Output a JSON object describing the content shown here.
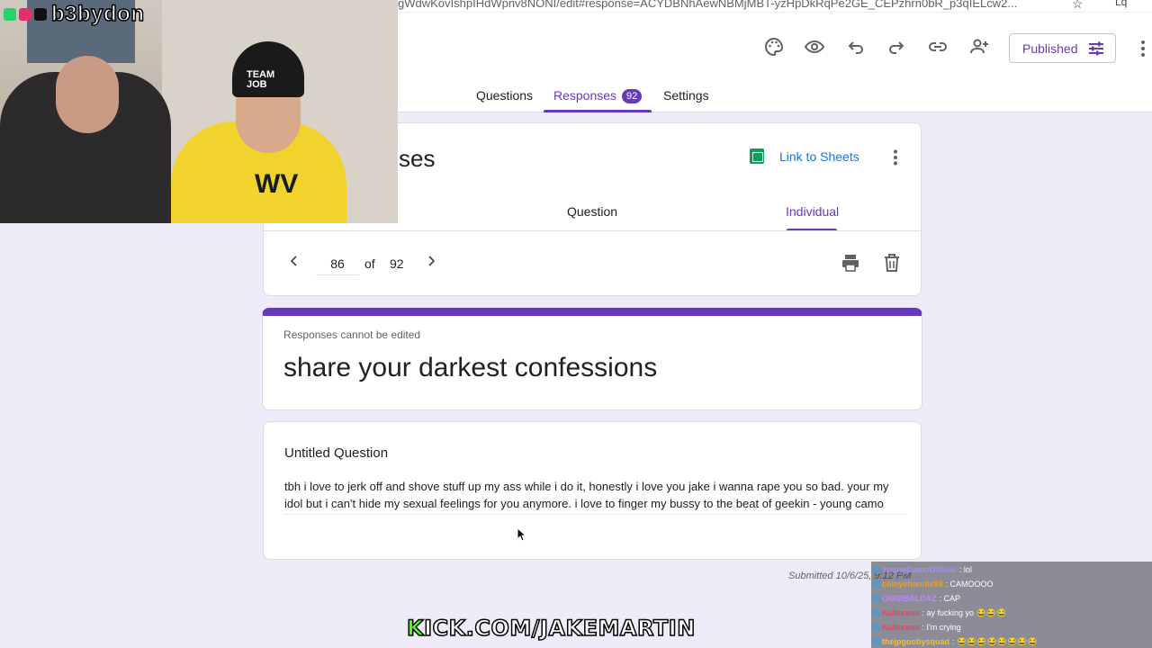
{
  "browser": {
    "url": "gWdwKovIshpIHdWpnv8NONI/edit#response=ACYDBNhAewNBMjMBT-yzHpDkRqPe2GE_CEPzhrn0bR_p3qIELcw2..."
  },
  "header": {
    "published_label": "Published",
    "tabs": {
      "questions": "Questions",
      "responses": "Responses",
      "responses_count": "92",
      "settings": "Settings"
    }
  },
  "summary": {
    "title_partial": "ses",
    "link_sheets": "Link to Sheets",
    "subtabs": {
      "question": "Question",
      "individual": "Individual"
    }
  },
  "navigator": {
    "current": "86",
    "of": "of",
    "total": "92"
  },
  "form": {
    "note": "Responses cannot be edited",
    "title": "share your darkest confessions"
  },
  "question": {
    "title": "Untitled Question",
    "answer": "tbh i love to jerk off and shove stuff up my ass while i do it, honestly i love you jake i wanna rape you so bad. your my idol but i can't hide my sexual feelings for you anymore. i love to finger my bussy to the beat of geekin - young camo"
  },
  "submitted": "Submitted 10/6/25, 9:12 PM",
  "stream": {
    "handle": "b3bydon",
    "beanie_text": "TEAM\nJOB",
    "shirt_logo": "WV",
    "kick_prefix": "K",
    "kick_rest": "ICK.COM/JAKEMARTIN",
    "chat": [
      {
        "user": "YoungCamoOfficial",
        "msg": ": lol",
        "color": "#a78bfa"
      },
      {
        "user": "billnyehandle98",
        "msg": ": CAMOOOO",
        "color": "#f59e0b"
      },
      {
        "user": "OGGIBALDAZ",
        "msg": ": CAP",
        "color": "#c084fc"
      },
      {
        "user": "Kulturess",
        "msg": ": ay fucking yo 😂😂😂",
        "color": "#f43f5e"
      },
      {
        "user": "Kulturess",
        "msg": ": I'm crying",
        "color": "#f43f5e"
      },
      {
        "user": "thejpgoobysquad",
        "msg": ": 😂😂😂😂😂😂😂😂",
        "color": "#fbbf24"
      }
    ]
  },
  "colors": {
    "accent": "#673ab7",
    "link": "#1a73e8",
    "sheets": "#0f9d58"
  }
}
